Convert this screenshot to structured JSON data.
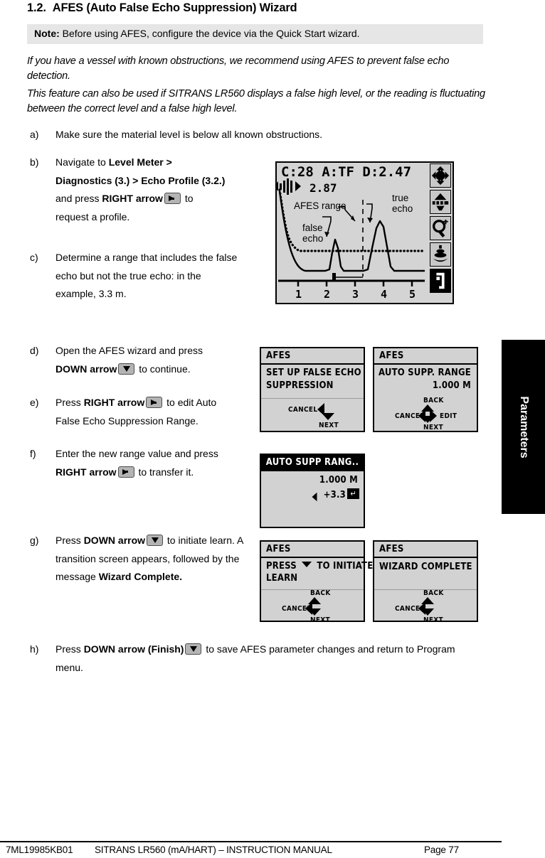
{
  "heading": {
    "number": "1.2.",
    "title": "AFES (Auto False Echo Suppression) Wizard"
  },
  "note": {
    "label": "Note:",
    "text": "Before using AFES, configure the device via the Quick Start wizard."
  },
  "intro": {
    "para1": "If you have a vessel with known obstructions, we recommend using AFES to prevent false echo detection.",
    "para2": "This feature can also be used if SITRANS LR560 displays a false high level, or the reading is fluctuating between the correct level and a false high level."
  },
  "steps": {
    "a": {
      "marker": "a)",
      "text": "Make sure the material level is below all known obstructions."
    },
    "b": {
      "marker": "b)",
      "t1": "Navigate to ",
      "b1": "Level Meter >",
      "b2": "Diagnostics (3.) > Echo Profile (3.2.)",
      "t2": "and press ",
      "b3": "RIGHT arrow",
      "key": "right-arrow-key",
      "t3": " to",
      "t4": "request a profile."
    },
    "c": {
      "marker": "c)",
      "text": "Determine a range that includes the false echo but not the true echo: in the example, 3.3 m."
    },
    "d": {
      "marker": "d)",
      "t1": "Open the AFES wizard and press",
      "b1": "DOWN arrow",
      "key": "down-arrow-key",
      "t2": " to continue."
    },
    "e": {
      "marker": "e)",
      "t1": "Press ",
      "b1": "RIGHT arrow",
      "key": "right-arrow-key",
      "t2": " to edit Auto False Echo Suppression Range."
    },
    "f": {
      "marker": "f)",
      "t1": "Enter the new range value and press",
      "b1": "RIGHT arrow",
      "key": "right-arrow-key",
      "t2": " to transfer it."
    },
    "g": {
      "marker": "g)",
      "t1": "Press ",
      "b1": "DOWN arrow",
      "key": "down-arrow-key",
      "t2": " to initiate learn. A transition screen appears, followed by the message ",
      "b2": "Wizard Complete."
    },
    "h": {
      "marker": "h)",
      "t1": "Press ",
      "b1": "DOWN arrow (Finish)",
      "key": "down-arrow-key",
      "t2": " to save AFES parameter changes and return to Program menu."
    }
  },
  "echo_profile": {
    "header": "C:28   A:TF D:2.47",
    "value": "2.87",
    "label_afes_range": "AFES range",
    "label_false_echo_line1": "false",
    "label_false_echo_line2": "echo",
    "label_true_echo_line1": "true",
    "label_true_echo_line2": "echo",
    "axis_labels": [
      "1",
      "2",
      "3",
      "4",
      "5"
    ],
    "icons": [
      "crosshair-icon",
      "level-icon",
      "zoom-icon",
      "echo-icon",
      "exit-icon"
    ]
  },
  "screens": {
    "s1": {
      "title": "AFES",
      "line1": "SET UP FALSE ECHO",
      "line2": "SUPPRESSION",
      "nav_cancel": "CANCEL",
      "nav_next": "NEXT"
    },
    "s2": {
      "title": "AFES",
      "line1": "AUTO SUPP. RANGE",
      "line2": "1.000 M",
      "nav_back": "BACK",
      "nav_cancel": "CANCEL",
      "nav_edit": "EDIT",
      "nav_next": "NEXT"
    },
    "s3": {
      "title": "AUTO SUPP RANG..",
      "line1": "1.000 M",
      "line2": "+3.3",
      "enter": "↵"
    },
    "s4": {
      "title": "AFES",
      "line1a": "PRESS",
      "line1b": "TO INITIATE",
      "line2": "LEARN",
      "nav_back": "BACK",
      "nav_cancel": "CANCEL",
      "nav_next": "NEXT"
    },
    "s5": {
      "title": "AFES",
      "line1": "WIZARD COMPLETE",
      "nav_back": "BACK",
      "nav_cancel": "CANCEL",
      "nav_next": "NEXT"
    }
  },
  "sidetab": {
    "label": "Parameters"
  },
  "footer": {
    "code": "7ML19985KB01",
    "title": "SITRANS LR560 (mA/HART) – INSTRUCTION MANUAL",
    "page": "Page 77"
  }
}
